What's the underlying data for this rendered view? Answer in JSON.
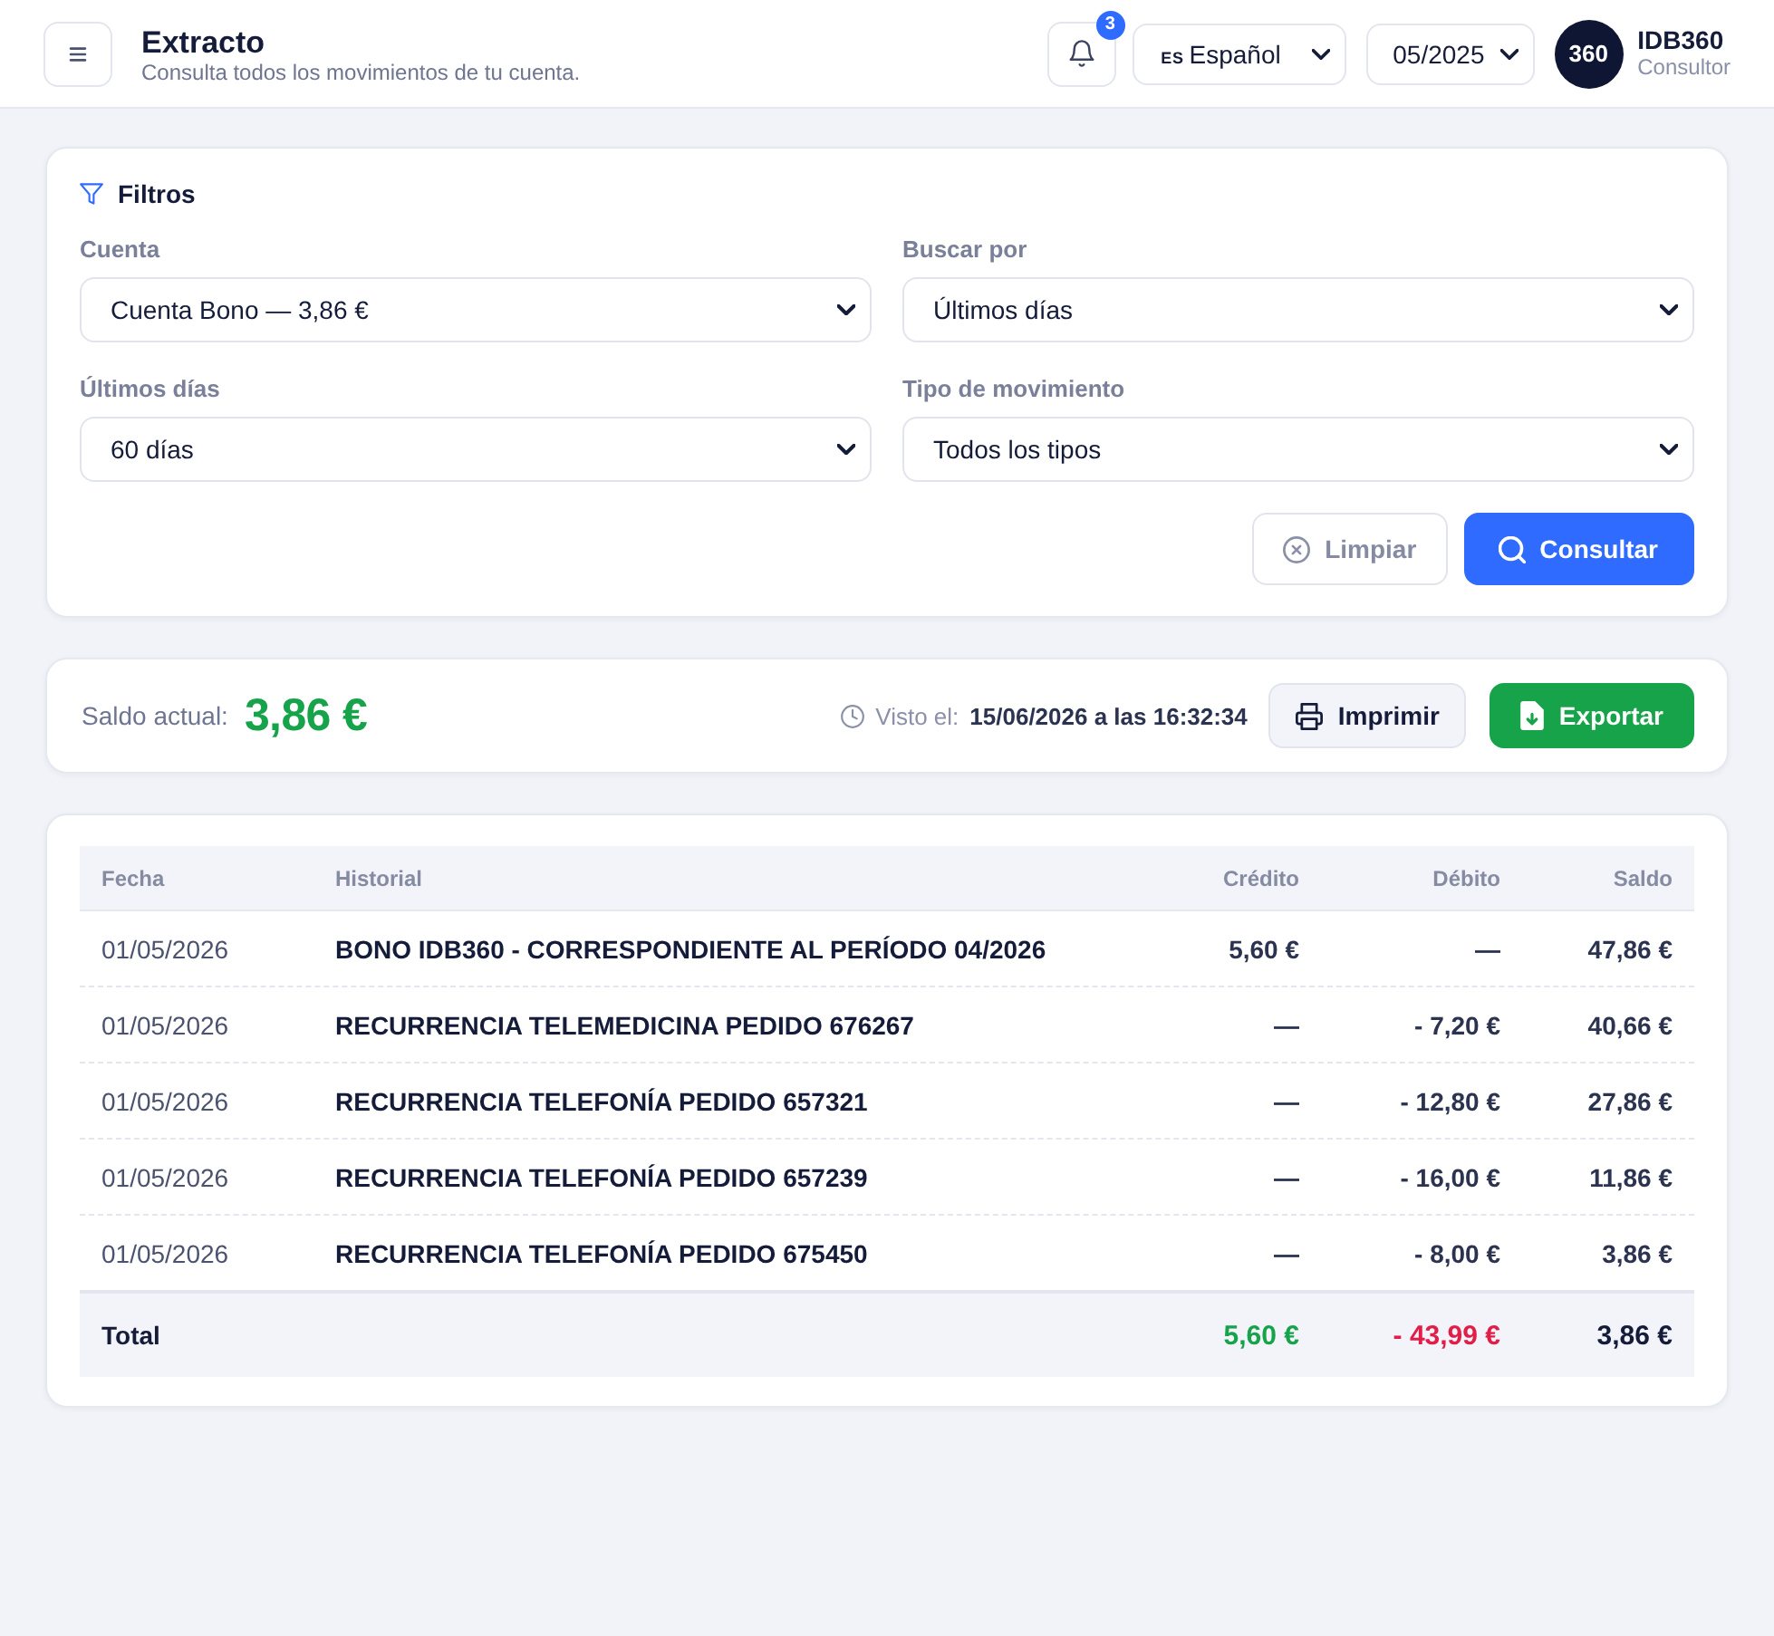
{
  "header": {
    "title": "Extracto",
    "subtitle": "Consulta todos los movimientos de tu cuenta.",
    "notification_count": "3",
    "language": {
      "flag": "ES",
      "value": "Español"
    },
    "period": "05/2025",
    "user": {
      "avatar": "360",
      "name": "IDB360",
      "role": "Consultor"
    }
  },
  "filters": {
    "title": "Filtros",
    "fields": [
      {
        "label": "Cuenta",
        "value": "Cuenta Bono — 3,86 €"
      },
      {
        "label": "Buscar por",
        "value": "Últimos días"
      },
      {
        "label": "Últimos días",
        "value": "60 días"
      },
      {
        "label": "Tipo de movimiento",
        "value": "Todos los tipos"
      }
    ],
    "buttons": [
      {
        "label": "Limpiar",
        "kind": "clear"
      },
      {
        "label": "Consultar",
        "kind": "search"
      }
    ]
  },
  "balance": {
    "label": "Saldo actual:",
    "amount": "3,86 €",
    "viewed_label": "Visto el:",
    "viewed_at": "15/06/2026 a las 16:32:34",
    "buttons": [
      {
        "label": "Imprimir",
        "kind": "print"
      },
      {
        "label": "Exportar",
        "kind": "export"
      }
    ]
  },
  "table": {
    "columns": [
      "Fecha",
      "Historial",
      "Crédito",
      "Débito",
      "Saldo"
    ],
    "rows": [
      {
        "date": "01/05/2026",
        "description": "BONO IDB360 - CORRESPONDIENTE AL PERÍODO 04/2026",
        "credit": "5,60 €",
        "debit": "—",
        "balance": "47,86 €"
      },
      {
        "date": "01/05/2026",
        "description": "RECURRENCIA TELEMEDICINA PEDIDO 676267",
        "credit": "—",
        "debit": "- 7,20 €",
        "balance": "40,66 €"
      },
      {
        "date": "01/05/2026",
        "description": "RECURRENCIA TELEFONÍA PEDIDO 657321",
        "credit": "—",
        "debit": "- 12,80 €",
        "balance": "27,86 €"
      },
      {
        "date": "01/05/2026",
        "description": "RECURRENCIA TELEFONÍA PEDIDO 657239",
        "credit": "—",
        "debit": "- 16,00 €",
        "balance": "11,86 €"
      },
      {
        "date": "01/05/2026",
        "description": "RECURRENCIA TELEFONÍA PEDIDO 675450",
        "credit": "—",
        "debit": "- 8,00 €",
        "balance": "3,86 €"
      }
    ],
    "total": {
      "label": "Total",
      "credit": "5,60 €",
      "debit": "- 43,99 €",
      "balance": "3,86 €"
    }
  }
}
